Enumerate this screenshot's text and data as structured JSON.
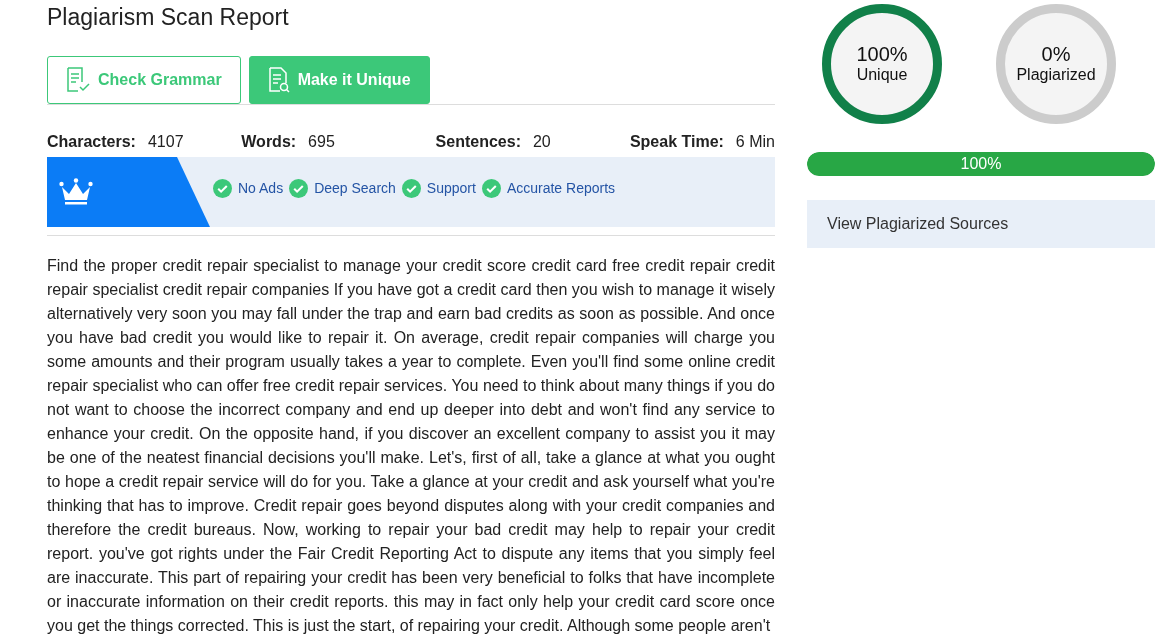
{
  "title": "Plagiarism Scan Report",
  "buttons": [
    {
      "label": "Check Grammar",
      "kind": "outline"
    },
    {
      "label": "Make it Unique",
      "kind": "filled"
    }
  ],
  "stats": [
    {
      "label": "Characters:",
      "value": "4107"
    },
    {
      "label": "Words:",
      "value": "695"
    },
    {
      "label": "Sentences:",
      "value": "20"
    },
    {
      "label": "Speak Time:",
      "value": "6 Min"
    }
  ],
  "features": [
    "No Ads",
    "Deep Search",
    "Support",
    "Accurate Reports"
  ],
  "text": "Find the proper credit repair specialist to manage your credit score credit card free credit repair credit repair specialist credit repair companies If you have got a credit card then you wish to manage it wisely alternatively very soon you may fall under the trap and earn bad credits as soon as possible. And once you have bad credit you would like to repair it. On average, credit repair companies will charge you some amounts and their program usually takes a year to complete. Even you'll find some online credit repair specialist who can offer free credit repair services. You need to think about many things if you do not want to choose the incorrect company and end up deeper into debt and won't find any service to enhance your credit. On the opposite hand, if you discover an excellent company to assist you it may be one of the neatest financial decisions you'll make. Let's, first of all, take a glance at what you ought to hope a credit repair service will do for you. Take a glance at your credit and ask yourself what you're thinking that has to improve. Credit repair goes beyond disputes along with your credit companies and therefore the credit bureaus. Now, working to repair your bad credit may help to repair your credit report. you've got rights under the Fair Credit Reporting Act to dispute any items that you simply feel are inaccurate. This part of repairing your credit has been very beneficial to folks that have incomplete or inaccurate information on their credit reports. this may in fact only help your credit card score once you get the things corrected. This is just the start, of repairing your credit. Although some people aren't",
  "rings": [
    {
      "value": "100%",
      "label": "Unique",
      "kind": "unique"
    },
    {
      "value": "0%",
      "label": "Plagiarized",
      "kind": "plagiarized"
    }
  ],
  "progress": {
    "level": 1,
    "reading": "100%"
  },
  "sources_link": "View Plagiarized Sources"
}
